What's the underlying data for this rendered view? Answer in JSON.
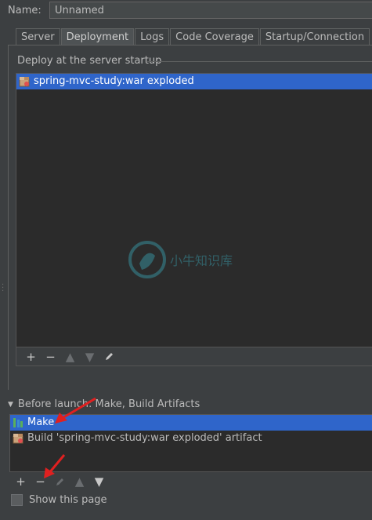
{
  "name_row": {
    "label": "Name:",
    "value": "Unnamed"
  },
  "tabs": [
    "Server",
    "Deployment",
    "Logs",
    "Code Coverage",
    "Startup/Connection"
  ],
  "active_tab": "Deployment",
  "deploy": {
    "title": "Deploy at the server startup",
    "items": [
      "spring-mvc-study:war exploded"
    ],
    "toolbar": [
      "add",
      "remove",
      "move-up",
      "move-down",
      "edit"
    ]
  },
  "before_launch": {
    "title": "Before launch: Make, Build Artifacts",
    "items": [
      "Make",
      "Build 'spring-mvc-study:war exploded' artifact"
    ],
    "toolbar": [
      "add",
      "remove",
      "edit",
      "move-up",
      "move-down"
    ]
  },
  "show_page": {
    "label": "Show this page",
    "checked": false
  },
  "watermark": {
    "text": "小牛知识库"
  },
  "colors": {
    "background": "#3c3f41",
    "list_bg": "#2b2b2b",
    "selection": "#2f65ca",
    "annotation_arrow": "#e02020"
  }
}
